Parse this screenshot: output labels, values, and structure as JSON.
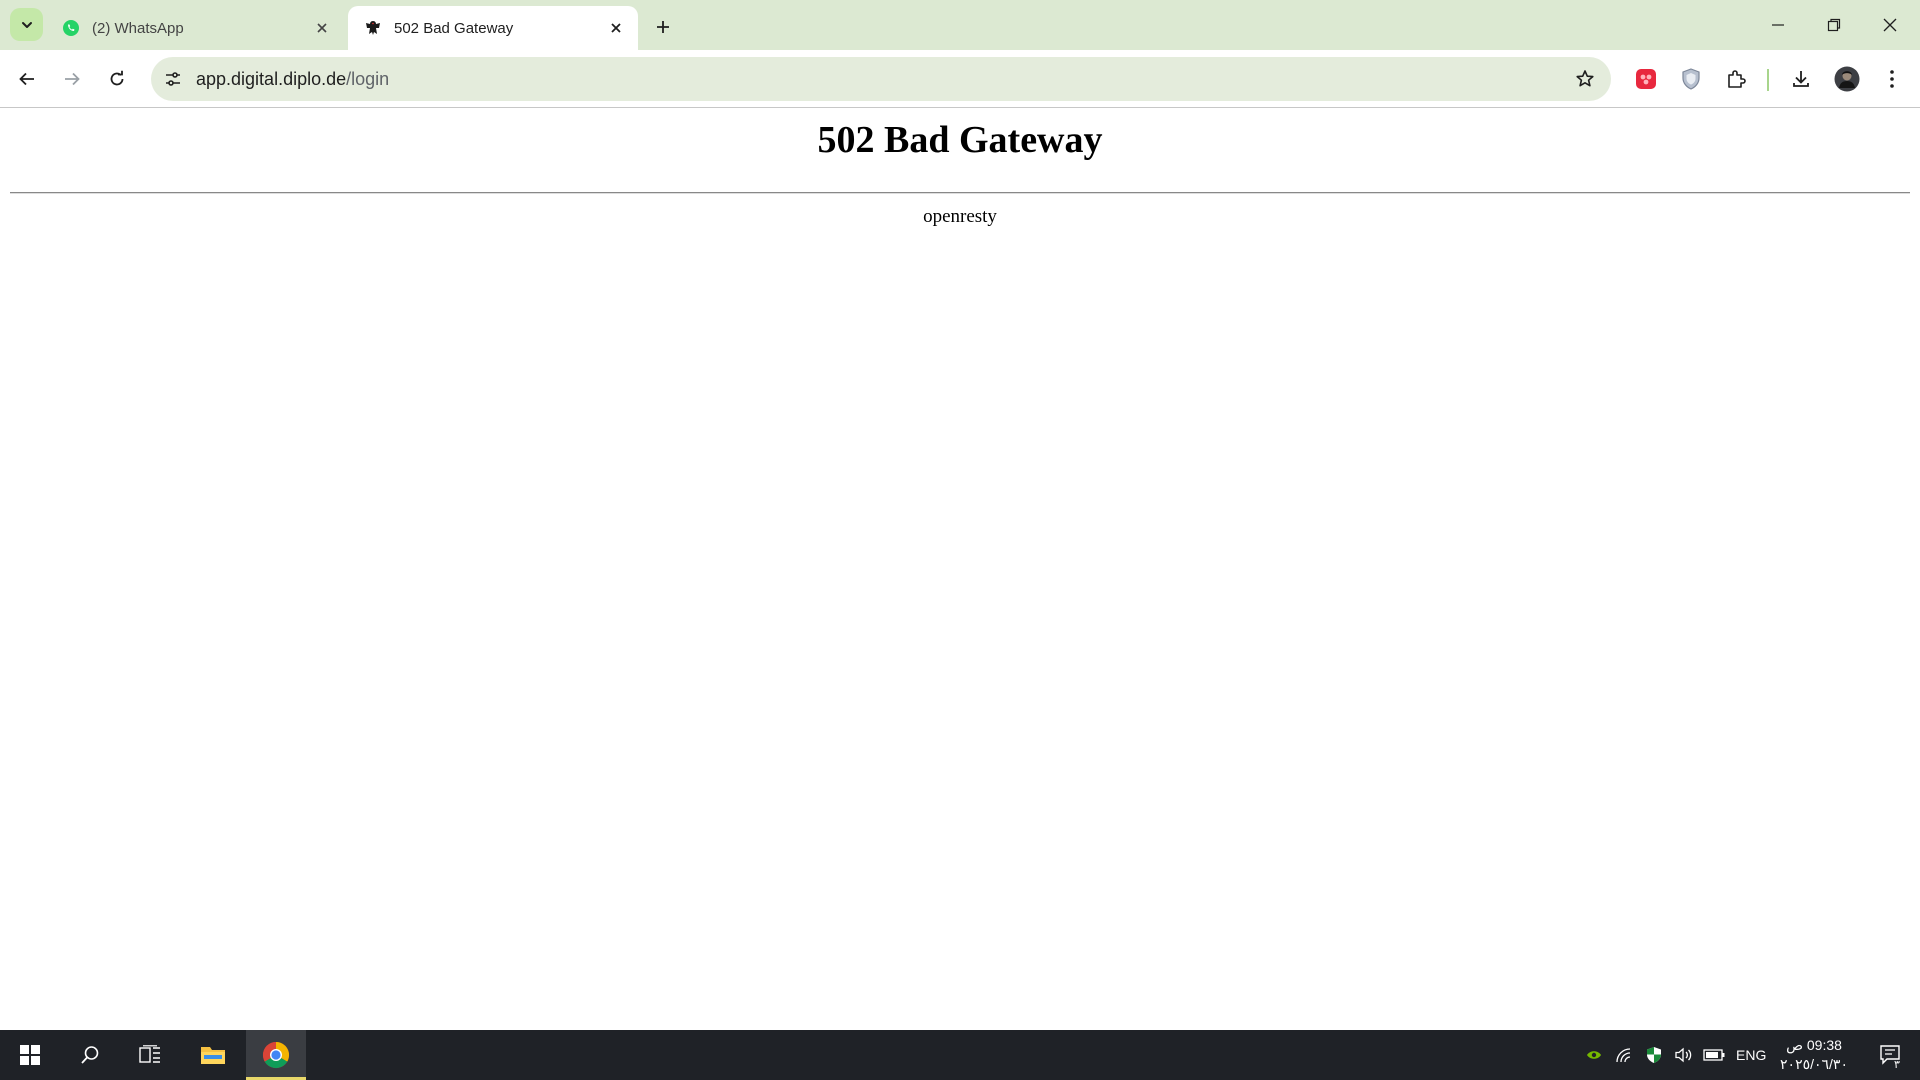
{
  "browser": {
    "tabs": [
      {
        "title": "(2) WhatsApp",
        "favicon": "whatsapp-icon",
        "active": false
      },
      {
        "title": "502 Bad Gateway",
        "favicon": "german-eagle-icon",
        "active": true
      }
    ],
    "address_bar": {
      "host": "app.digital.diplo.de",
      "path": "/login"
    },
    "accent_color": "#dce9d2"
  },
  "page": {
    "heading": "502 Bad Gateway",
    "server": "openresty"
  },
  "taskbar": {
    "language": "ENG",
    "time": "09:38 ص",
    "date": "٢٠٢٥/٠٦/٣٠",
    "notification_count": "٣"
  }
}
